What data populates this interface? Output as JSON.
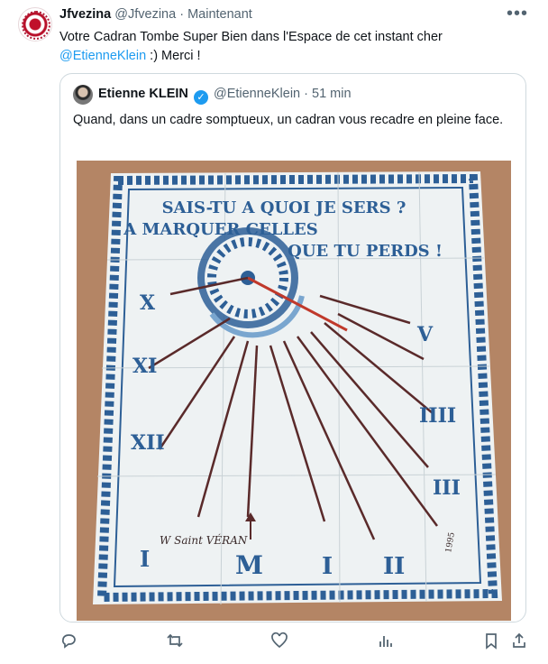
{
  "tweet": {
    "display_name": "Jfvezina",
    "handle": "@Jfvezina",
    "separator": "·",
    "time": "Maintenant",
    "more_label": "•••",
    "text_line1": "Votre Cadran Tombe Super Bien dans l'Espace de cet instant cher",
    "mention": "@EtienneKlein",
    "text_line2_rest": " :) Merci !"
  },
  "quote": {
    "display_name": "Etienne KLEIN",
    "handle": "@EtienneKlein",
    "separator": "·",
    "time": "51 min",
    "text": "Quand, dans un cadre somptueux, un cadran vous recadre en pleine face."
  },
  "sundial": {
    "motto_line1": "SAIS-TU A QUOI JE SERS ?",
    "motto_line2": "A MARQUER   CELLES",
    "motto_line3": "QUE TU PERDS !",
    "numeral_left_top": "X",
    "numeral_left_mid": "XI",
    "numeral_left_bottom": "XII",
    "numeral_right_top": "V",
    "numeral_right_mid": "IIII",
    "numeral_right_low": "III",
    "numeral_bottom_left": "I",
    "numeral_bottom_center": "M",
    "numeral_bottom_i1": "I",
    "numeral_bottom_i2": "II",
    "sign_label": "W   Saint   VÉRAN",
    "year": "1995",
    "colors": {
      "blue": "#2d5f96",
      "tile": "#eef2f3",
      "wall": "#b88a6a",
      "gnomon": "#c0392b"
    }
  },
  "actions": {
    "reply_icon": "reply-icon",
    "retweet_icon": "retweet-icon",
    "like_icon": "like-icon",
    "views_icon": "views-icon",
    "bookmark_icon": "bookmark-icon",
    "share_icon": "share-icon"
  }
}
